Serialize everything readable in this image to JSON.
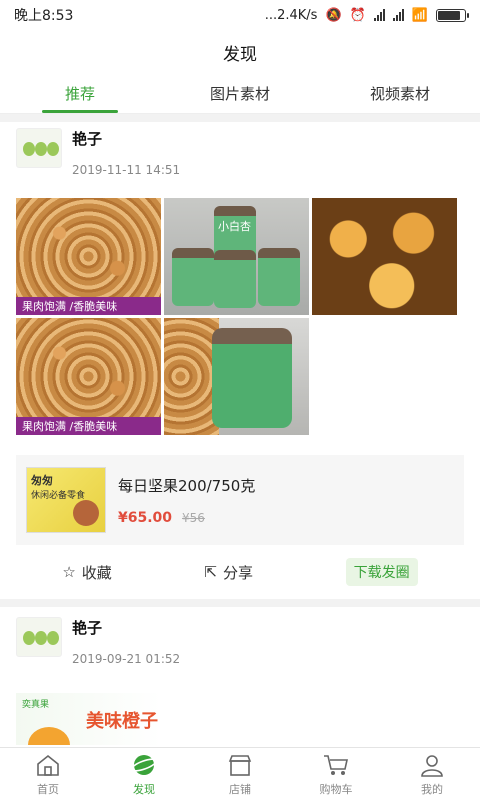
{
  "status_bar": {
    "time": "晚上8:53",
    "net_speed": "...2.4K/s"
  },
  "header": {
    "title": "发现"
  },
  "tabs": [
    {
      "label": "推荐"
    },
    {
      "label": "图片素材"
    },
    {
      "label": "视频素材"
    }
  ],
  "posts": [
    {
      "author": "艳子",
      "time": "2019-11-11 14:51",
      "image_captions": [
        "果肉饱满 /香脆美味",
        "果肉饱满 /香脆美味"
      ],
      "jar_label": "小白杏",
      "product": {
        "name": "每日坚果200/750克",
        "price": "¥65.00",
        "old_price": "¥56",
        "image_text": "休闲必备零食",
        "image_title": "匆匆"
      },
      "actions": {
        "collect": "收藏",
        "share": "分享",
        "download": "下载发圈"
      }
    },
    {
      "author": "艳子",
      "time": "2019-09-21 01:52",
      "banner_brand": "奕真果",
      "banner_text": "美味橙子"
    }
  ],
  "bottom_nav": [
    {
      "label": "首页",
      "icon": "home-icon"
    },
    {
      "label": "发现",
      "icon": "discover-icon"
    },
    {
      "label": "店铺",
      "icon": "store-icon"
    },
    {
      "label": "购物车",
      "icon": "cart-icon"
    },
    {
      "label": "我的",
      "icon": "user-icon"
    }
  ],
  "colors": {
    "accent": "#3aa33a",
    "price": "#e14c3c",
    "caption_bg": "#8a2a8a"
  }
}
